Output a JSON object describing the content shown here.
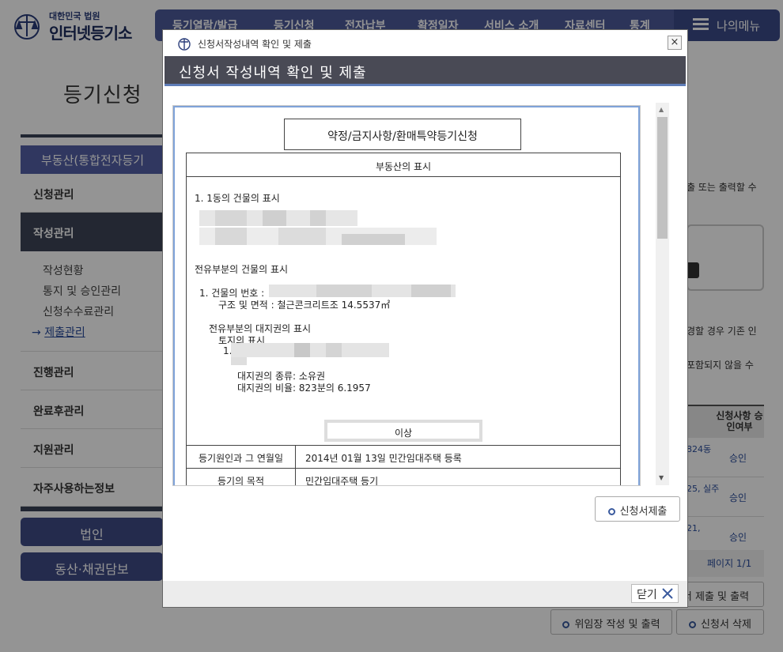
{
  "site": {
    "logo_small": "대한민국 법원",
    "logo_big": "인터넷등기소",
    "nav": [
      "등기열람/발급",
      "등기신청",
      "전자납부",
      "확정일자",
      "서비스 소개",
      "자료센터",
      "통계"
    ],
    "my_menu": "나의메뉴",
    "page_title": "등기신청"
  },
  "sidebar": {
    "head": "부동산(통합전자등기",
    "items": [
      "신청관리",
      "작성관리",
      "진행관리",
      "완료후관리",
      "지원관리",
      "자주사용하는정보"
    ],
    "subs": [
      "작성현황",
      "통지 및 승인관리",
      "신청수수료관리",
      "제출관리"
    ],
    "current_marker": "→",
    "btn_corp": "법인",
    "btn_movable": "동산·채권담보"
  },
  "right": {
    "line1": "출 또는 출력할 수",
    "line2": "경할 경우 기존 인",
    "line3": "포함되지 않을 수",
    "table_header": "신청사항 승인여부",
    "rows": [
      {
        "a": "824동",
        "b": "승인"
      },
      {
        "a": "25, 실주",
        "b": "승인"
      },
      {
        "a": "21,",
        "b": "승인"
      }
    ],
    "pager": "페이지 1/1",
    "btn_submit_print": "서 제출 및 출력",
    "btn_proxy": "위임장 작성 및 출력",
    "btn_delete": "신청서 삭제"
  },
  "modal": {
    "window_title": "신청서작성내역 확인 및 제출",
    "close_glyph": "×",
    "header": "신청서 작성내역 확인 및 제출",
    "doc": {
      "title": "약정/금지사항/환매특약등기신청",
      "caption": "부동산의 표시",
      "building_1": "1. 1동의 건물의 표시",
      "exclusive_title": "전유부분의 건물의 표시",
      "bldg_no": "1. 건물의 번호 :",
      "structure": "구조 및 면적 : 철근콘크리트조 14.5537㎡",
      "land_right_title": "전유부분의 대지권의 표시",
      "land_title": "토지의 표시",
      "land_no": "1.",
      "land_kind": "대지권의 종류: 소유권",
      "land_ratio": "대지권의 비율: 823분의 6.1957",
      "end_mark": "이상",
      "rows": [
        {
          "k": "등기원인과 그 연월일",
          "v": "2014년 01월 13일   민간임대주택 등록"
        },
        {
          "k": "등기의 목적",
          "v": "민간임대주택 등기"
        }
      ]
    },
    "submit_btn": "신청서제출",
    "close_btn": "닫기"
  }
}
